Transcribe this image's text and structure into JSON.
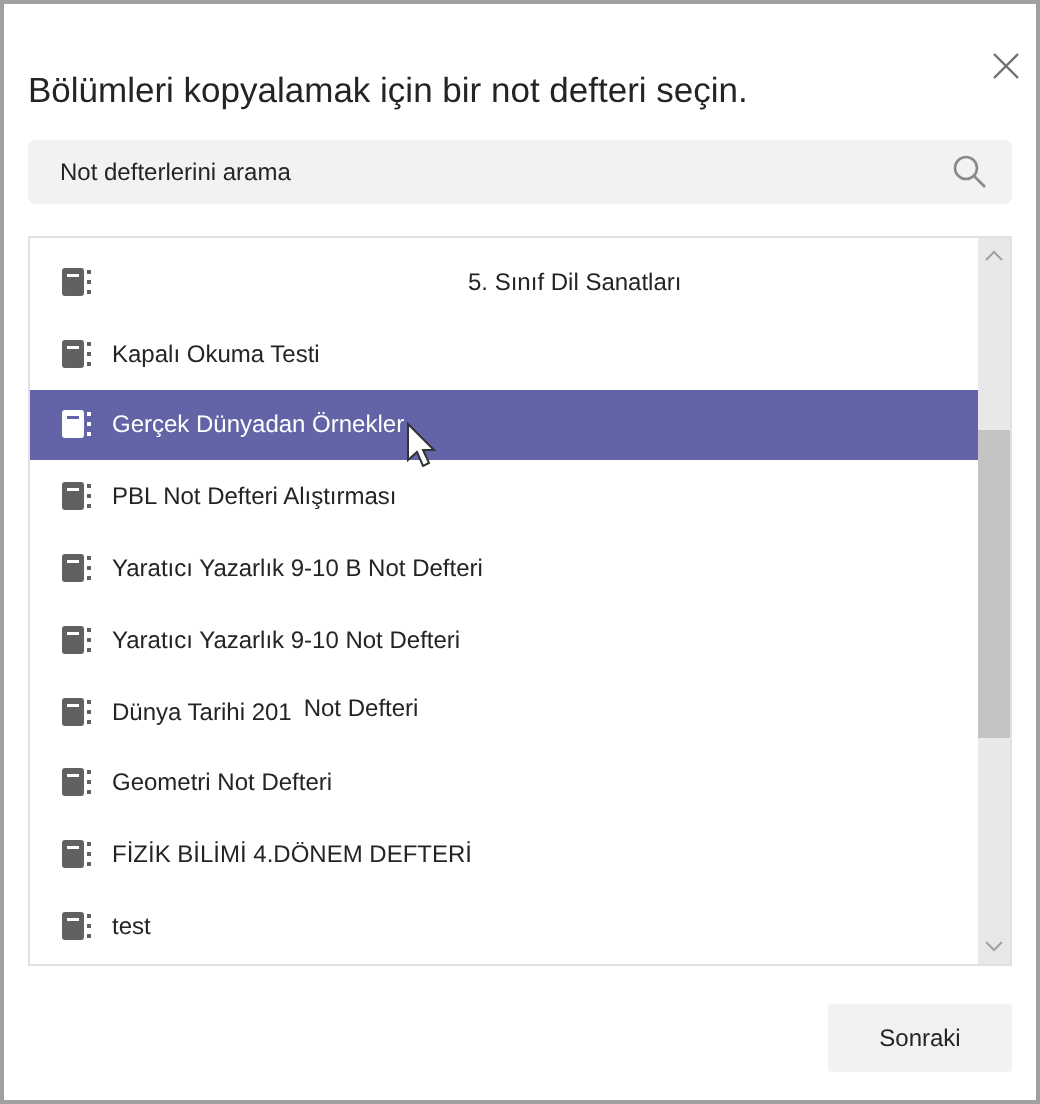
{
  "dialog": {
    "title": "Bölümleri kopyalamak için bir not defteri seçin."
  },
  "search": {
    "placeholder": "Not defterlerini arama"
  },
  "notebooks": [
    {
      "kind": "offset",
      "parts": [
        "5. Sınıf Dil Sanatları"
      ],
      "selected": false
    },
    {
      "kind": "plain",
      "parts": [
        "Kapalı Okuma Testi"
      ],
      "selected": false
    },
    {
      "kind": "plain",
      "parts": [
        "Gerçek Dünyadan Örnekler"
      ],
      "selected": true
    },
    {
      "kind": "plain",
      "parts": [
        "PBL Not Defteri Alıştırması"
      ],
      "selected": false
    },
    {
      "kind": "plain",
      "parts": [
        "Yaratıcı Yazarlık 9-10 B Not Defteri"
      ],
      "selected": false
    },
    {
      "kind": "plain",
      "parts": [
        "Yaratıcı Yazarlık 9-10 Not Defteri"
      ],
      "selected": false
    },
    {
      "kind": "split",
      "parts": [
        "Dünya Tarihi 201",
        "Not Defteri"
      ],
      "selected": false
    },
    {
      "kind": "plain",
      "parts": [
        "Geometri Not Defteri"
      ],
      "selected": false
    },
    {
      "kind": "plain",
      "parts": [
        "FİZİK BİLİMİ 4.DÖNEM DEFTERİ"
      ],
      "selected": false
    },
    {
      "kind": "plain",
      "parts": [
        "test"
      ],
      "selected": false
    }
  ],
  "buttons": [
    "Sonraki"
  ]
}
